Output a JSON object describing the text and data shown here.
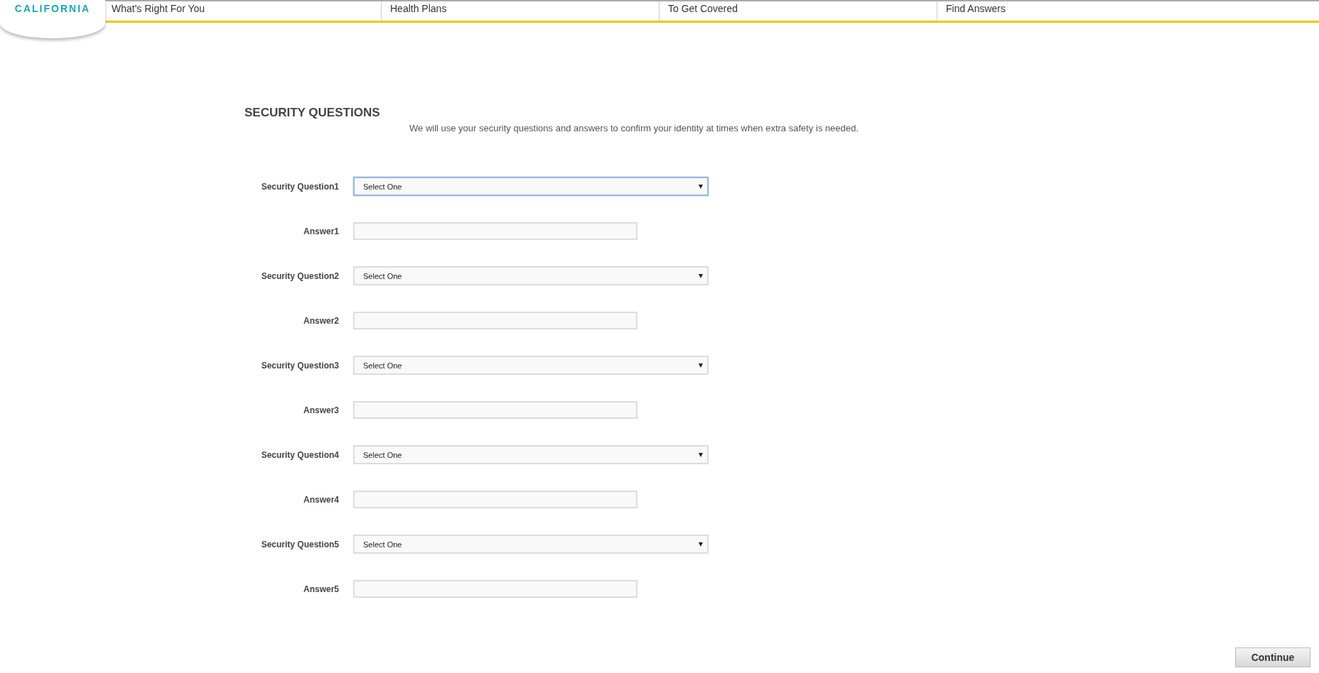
{
  "header": {
    "logo_text": "CALIFORNIA",
    "nav": [
      {
        "label": "What's Right For You"
      },
      {
        "label": "Health Plans"
      },
      {
        "label": "To Get Covered"
      },
      {
        "label": "Find Answers"
      }
    ]
  },
  "form": {
    "title": "SECURITY QUESTIONS",
    "description": "We will use your security questions and answers to confirm your identity at times when extra safety is needed.",
    "rows": [
      {
        "question_label": "Security Question1",
        "select_value": "Select One",
        "focused": true,
        "answer_label": "Answer1"
      },
      {
        "question_label": "Security Question2",
        "select_value": "Select One",
        "focused": false,
        "answer_label": "Answer2"
      },
      {
        "question_label": "Security Question3",
        "select_value": "Select One",
        "focused": false,
        "answer_label": "Answer3"
      },
      {
        "question_label": "Security Question4",
        "select_value": "Select One",
        "focused": false,
        "answer_label": "Answer4"
      },
      {
        "question_label": "Security Question5",
        "select_value": "Select One",
        "focused": false,
        "answer_label": "Answer5"
      }
    ],
    "continue_button": "Continue"
  }
}
